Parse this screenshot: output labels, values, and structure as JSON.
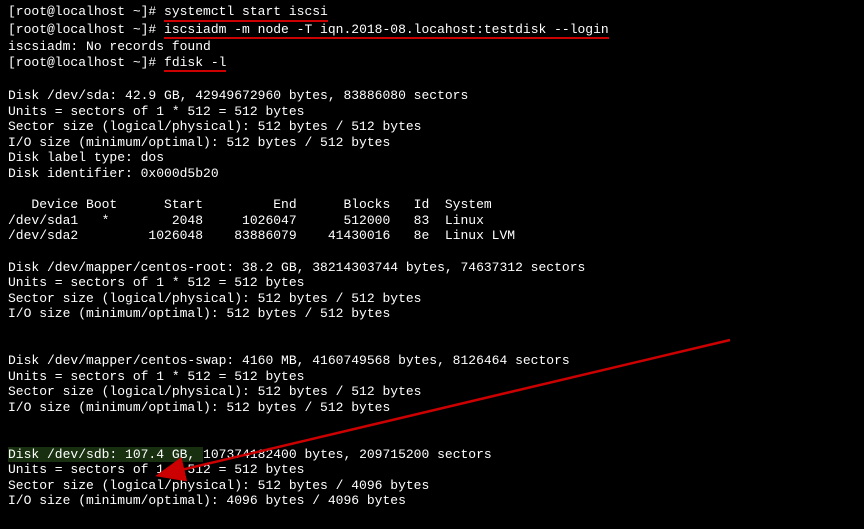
{
  "prompt": "[root@localhost ~]# ",
  "commands": {
    "cmd1": "systemctl start iscsi",
    "cmd2": "iscsiadm -m node -T iqn.2018-08.locahost:testdisk --login",
    "cmd2_error": "iscsiadm: No records found",
    "cmd3": "fdisk -l"
  },
  "disk_sda": {
    "header": "Disk /dev/sda: 42.9 GB, 42949672960 bytes, 83886080 sectors",
    "units": "Units = sectors of 1 * 512 = 512 bytes",
    "sector": "Sector size (logical/physical): 512 bytes / 512 bytes",
    "io": "I/O size (minimum/optimal): 512 bytes / 512 bytes",
    "label": "Disk label type: dos",
    "identifier": "Disk identifier: 0x000d5b20"
  },
  "partition_table": {
    "header": "   Device Boot      Start         End      Blocks   Id  System",
    "row1": "/dev/sda1   *        2048     1026047      512000   83  Linux",
    "row2": "/dev/sda2         1026048    83886079    41430016   8e  Linux LVM"
  },
  "mapper_root": {
    "header": "Disk /dev/mapper/centos-root: 38.2 GB, 38214303744 bytes, 74637312 sectors",
    "units": "Units = sectors of 1 * 512 = 512 bytes",
    "sector": "Sector size (logical/physical): 512 bytes / 512 bytes",
    "io": "I/O size (minimum/optimal): 512 bytes / 512 bytes"
  },
  "mapper_swap": {
    "header": "Disk /dev/mapper/centos-swap: 4160 MB, 4160749568 bytes, 8126464 sectors",
    "units": "Units = sectors of 1 * 512 = 512 bytes",
    "sector": "Sector size (logical/physical): 512 bytes / 512 bytes",
    "io": "I/O size (minimum/optimal): 512 bytes / 512 bytes"
  },
  "disk_sdb": {
    "header_part1": "Disk /dev/sdb: 107.4 GB, ",
    "header_part2": "107374182400 bytes, 209715200 sectors",
    "units": "Units = sectors of 1 * 512 = 512 bytes",
    "sector": "Sector size (logical/physical): 512 bytes / 4096 bytes",
    "io": "I/O size (minimum/optimal): 4096 bytes / 4096 bytes"
  }
}
